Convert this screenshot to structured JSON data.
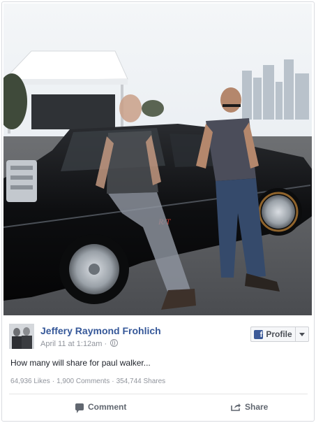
{
  "post": {
    "author": "Jeffery Raymond Frohlich",
    "timestamp": "April 11 at 1:12am",
    "privacy_icon": "globe-icon",
    "text": "How many will share for paul walker...",
    "profile_button": {
      "label": "Profile",
      "icon": "facebook-f-icon",
      "caret": "chevron-down-icon"
    },
    "stats": {
      "likes": "64,936 Likes",
      "comments": "1,900 Comments",
      "shares": "354,744 Shares",
      "separator": "·"
    },
    "actions": {
      "comment_label": "Comment",
      "share_label": "Share"
    },
    "photo": {
      "description_icon": "photo-image",
      "emblem": "R/T"
    }
  },
  "colors": {
    "link_blue": "#365899",
    "meta_gray": "#90949c",
    "facebook_blue": "#3b5998",
    "car_black": "#111214"
  }
}
